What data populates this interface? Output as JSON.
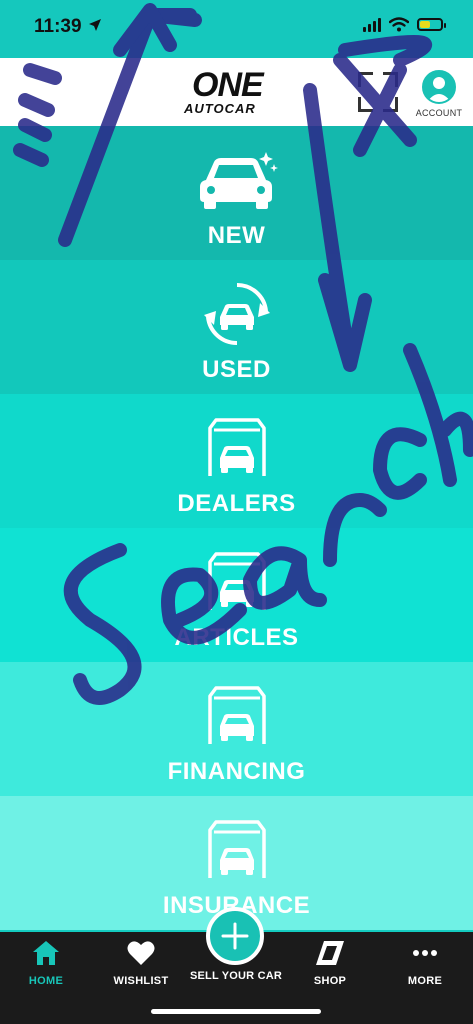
{
  "status_bar": {
    "time": "11:39"
  },
  "header": {
    "logo_top": "ONE",
    "logo_bottom": "AUTOCAR",
    "account_label": "ACCOUNT"
  },
  "menu": [
    {
      "label": "NEW",
      "icon": "car-sparkle-icon",
      "bg": "#14b8ad"
    },
    {
      "label": "USED",
      "icon": "car-cycle-icon",
      "bg": "#12c8bb"
    },
    {
      "label": "DEALERS",
      "icon": "garage-car-icon",
      "bg": "#10d9cb"
    },
    {
      "label": "ARTICLES",
      "icon": "garage-car-icon",
      "bg": "#10e2d3"
    },
    {
      "label": "FINANCING",
      "icon": "garage-car-icon",
      "bg": "#3eeadc"
    },
    {
      "label": "INSURANCE",
      "icon": "garage-car-icon",
      "bg": "#6ff1e5"
    }
  ],
  "bottom_nav": {
    "home": "HOME",
    "wishlist": "WISHLIST",
    "sell": "SELL YOUR CAR",
    "shop": "SHOP",
    "more": "MORE"
  },
  "colors": {
    "accent": "#19c1b4",
    "nav_bg": "#1b1b1b",
    "scribble": "#2a2a8a"
  }
}
